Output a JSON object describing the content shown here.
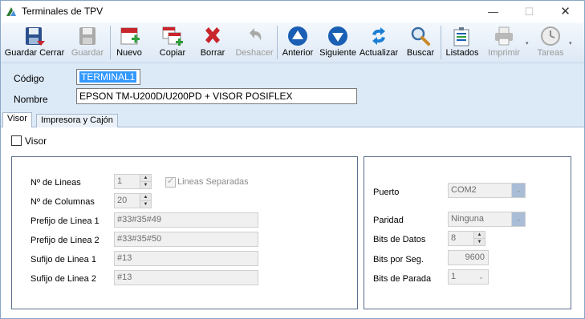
{
  "window": {
    "title": "Terminales de TPV",
    "min_glyph": "—",
    "max_glyph": "☐",
    "close_glyph": "✕"
  },
  "toolbar": {
    "buttons": [
      {
        "label": "Guardar Cerrar",
        "icon": "save-close-icon",
        "enabled": true
      },
      {
        "label": "Guardar",
        "icon": "save-icon",
        "enabled": false
      },
      {
        "label": "Nuevo",
        "icon": "new-icon",
        "enabled": true
      },
      {
        "label": "Copiar",
        "icon": "copy-icon",
        "enabled": true
      },
      {
        "label": "Borrar",
        "icon": "delete-icon",
        "enabled": true
      },
      {
        "label": "Deshacer",
        "icon": "undo-icon",
        "enabled": false
      },
      {
        "label": "Anterior",
        "icon": "previous-icon",
        "enabled": true
      },
      {
        "label": "Siguiente",
        "icon": "next-icon",
        "enabled": true
      },
      {
        "label": "Actualizar",
        "icon": "refresh-icon",
        "enabled": true
      },
      {
        "label": "Buscar",
        "icon": "search-icon",
        "enabled": true
      },
      {
        "label": "Listados",
        "icon": "reports-icon",
        "enabled": true
      },
      {
        "label": "Imprimir",
        "icon": "print-icon",
        "enabled": false
      },
      {
        "label": "Tareas",
        "icon": "tasks-icon",
        "enabled": false
      }
    ],
    "dropdown_glyph": "▾"
  },
  "header": {
    "codigo_label": "Código",
    "codigo_value": "TERMINAL1",
    "nombre_label": "Nombre",
    "nombre_value": "EPSON TM-U200D/U200PD  + VISOR POSIFLEX"
  },
  "tabs": [
    {
      "label": "Visor",
      "active": true
    },
    {
      "label": "Impresora y Cajón",
      "active": false
    }
  ],
  "visor": {
    "visor_checkbox_label": "Visor",
    "visor_checked": false,
    "left": {
      "lineas_label": "Nº de Lineas",
      "lineas_value": "1",
      "lineas_separadas_label": "Lineas Separadas",
      "lineas_separadas_checked": true,
      "columnas_label": "Nº de Columnas",
      "columnas_value": "20",
      "prefijo1_label": "Prefijo de Linea 1",
      "prefijo1_value": "#33#35#49",
      "prefijo2_label": "Prefijo de Linea 2",
      "prefijo2_value": "#33#35#50",
      "sufijo1_label": "Sufijo de Linea 1",
      "sufijo1_value": "#13",
      "sufijo2_label": "Sufijo de Linea 2",
      "sufijo2_value": "#13"
    },
    "right": {
      "puerto_label": "Puerto",
      "puerto_value": "COM2",
      "paridad_label": "Paridad",
      "paridad_value": "Ninguna",
      "bits_datos_label": "Bits de Datos",
      "bits_datos_value": "8",
      "bits_seg_label": "Bits por Seg.",
      "bits_seg_value": "9600",
      "bits_parada_label": "Bits de Parada",
      "bits_parada_value": "1"
    }
  },
  "colors": {
    "toolbar_bg": "#dde8f5",
    "header_bg": "#dce9f7",
    "selection": "#3399ff",
    "delete_red": "#c8262c",
    "nav_blue": "#1a5fb4"
  }
}
